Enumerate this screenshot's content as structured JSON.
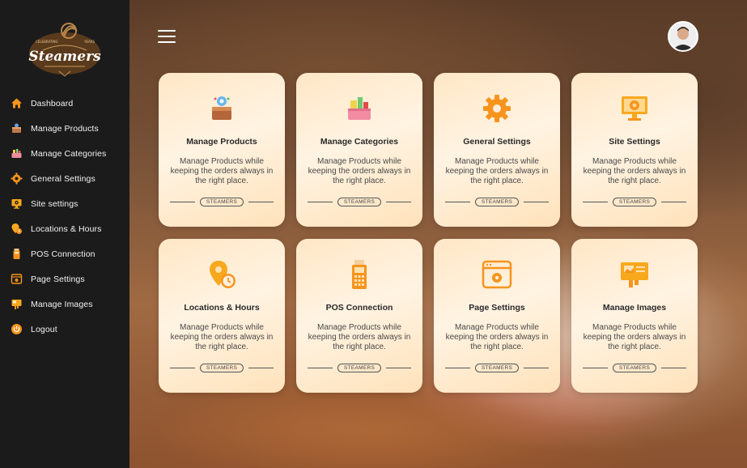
{
  "brand": {
    "logo_text": "Steamers",
    "logo_tagline_left": "CELEBRATING",
    "logo_tagline_right": "YEARS",
    "accent": "#f7941d",
    "sidebar_bg": "#1b1b1b"
  },
  "sidebar": {
    "items": [
      {
        "label": "Dashboard",
        "icon": "home-icon"
      },
      {
        "label": "Manage Products",
        "icon": "product-box-icon"
      },
      {
        "label": "Manage Categories",
        "icon": "categories-icon"
      },
      {
        "label": "General Settings",
        "icon": "gear-icon"
      },
      {
        "label": "Site settings",
        "icon": "site-monitor-icon"
      },
      {
        "label": "Locations & Hours",
        "icon": "location-clock-icon"
      },
      {
        "label": "POS Connection",
        "icon": "pos-terminal-icon"
      },
      {
        "label": "Page Settings",
        "icon": "page-settings-icon"
      },
      {
        "label": "Manage Images",
        "icon": "images-icon"
      },
      {
        "label": "Logout",
        "icon": "power-icon"
      }
    ]
  },
  "header": {
    "menu_icon": "hamburger-icon",
    "avatar": "user-avatar"
  },
  "cards": [
    {
      "title": "Manage Products",
      "desc": "Manage Products while keeping the orders always in the right place.",
      "tag": "STEAMERS",
      "icon": "product-box-icon"
    },
    {
      "title": "Manage Categories",
      "desc": "Manage Products while keeping the orders always in the right place.",
      "tag": "STEAMERS",
      "icon": "categories-icon"
    },
    {
      "title": "General Settings",
      "desc": "Manage Products while keeping the orders always in the right place.",
      "tag": "STEAMERS",
      "icon": "gear-icon"
    },
    {
      "title": "Site Settings",
      "desc": "Manage Products while keeping the orders always in the right place.",
      "tag": "STEAMERS",
      "icon": "site-monitor-icon"
    },
    {
      "title": "Locations & Hours",
      "desc": "Manage Products while keeping the orders always in the right place.",
      "tag": "STEAMERS",
      "icon": "location-clock-icon"
    },
    {
      "title": "POS Connection",
      "desc": "Manage Products while keeping the orders always in the right place.",
      "tag": "STEAMERS",
      "icon": "pos-terminal-icon"
    },
    {
      "title": "Page Settings",
      "desc": "Manage Products while keeping the orders always in the right place.",
      "tag": "STEAMERS",
      "icon": "page-settings-icon"
    },
    {
      "title": "Manage Images",
      "desc": "Manage Products while keeping the orders always in the right place.",
      "tag": "STEAMERS",
      "icon": "images-icon"
    }
  ]
}
